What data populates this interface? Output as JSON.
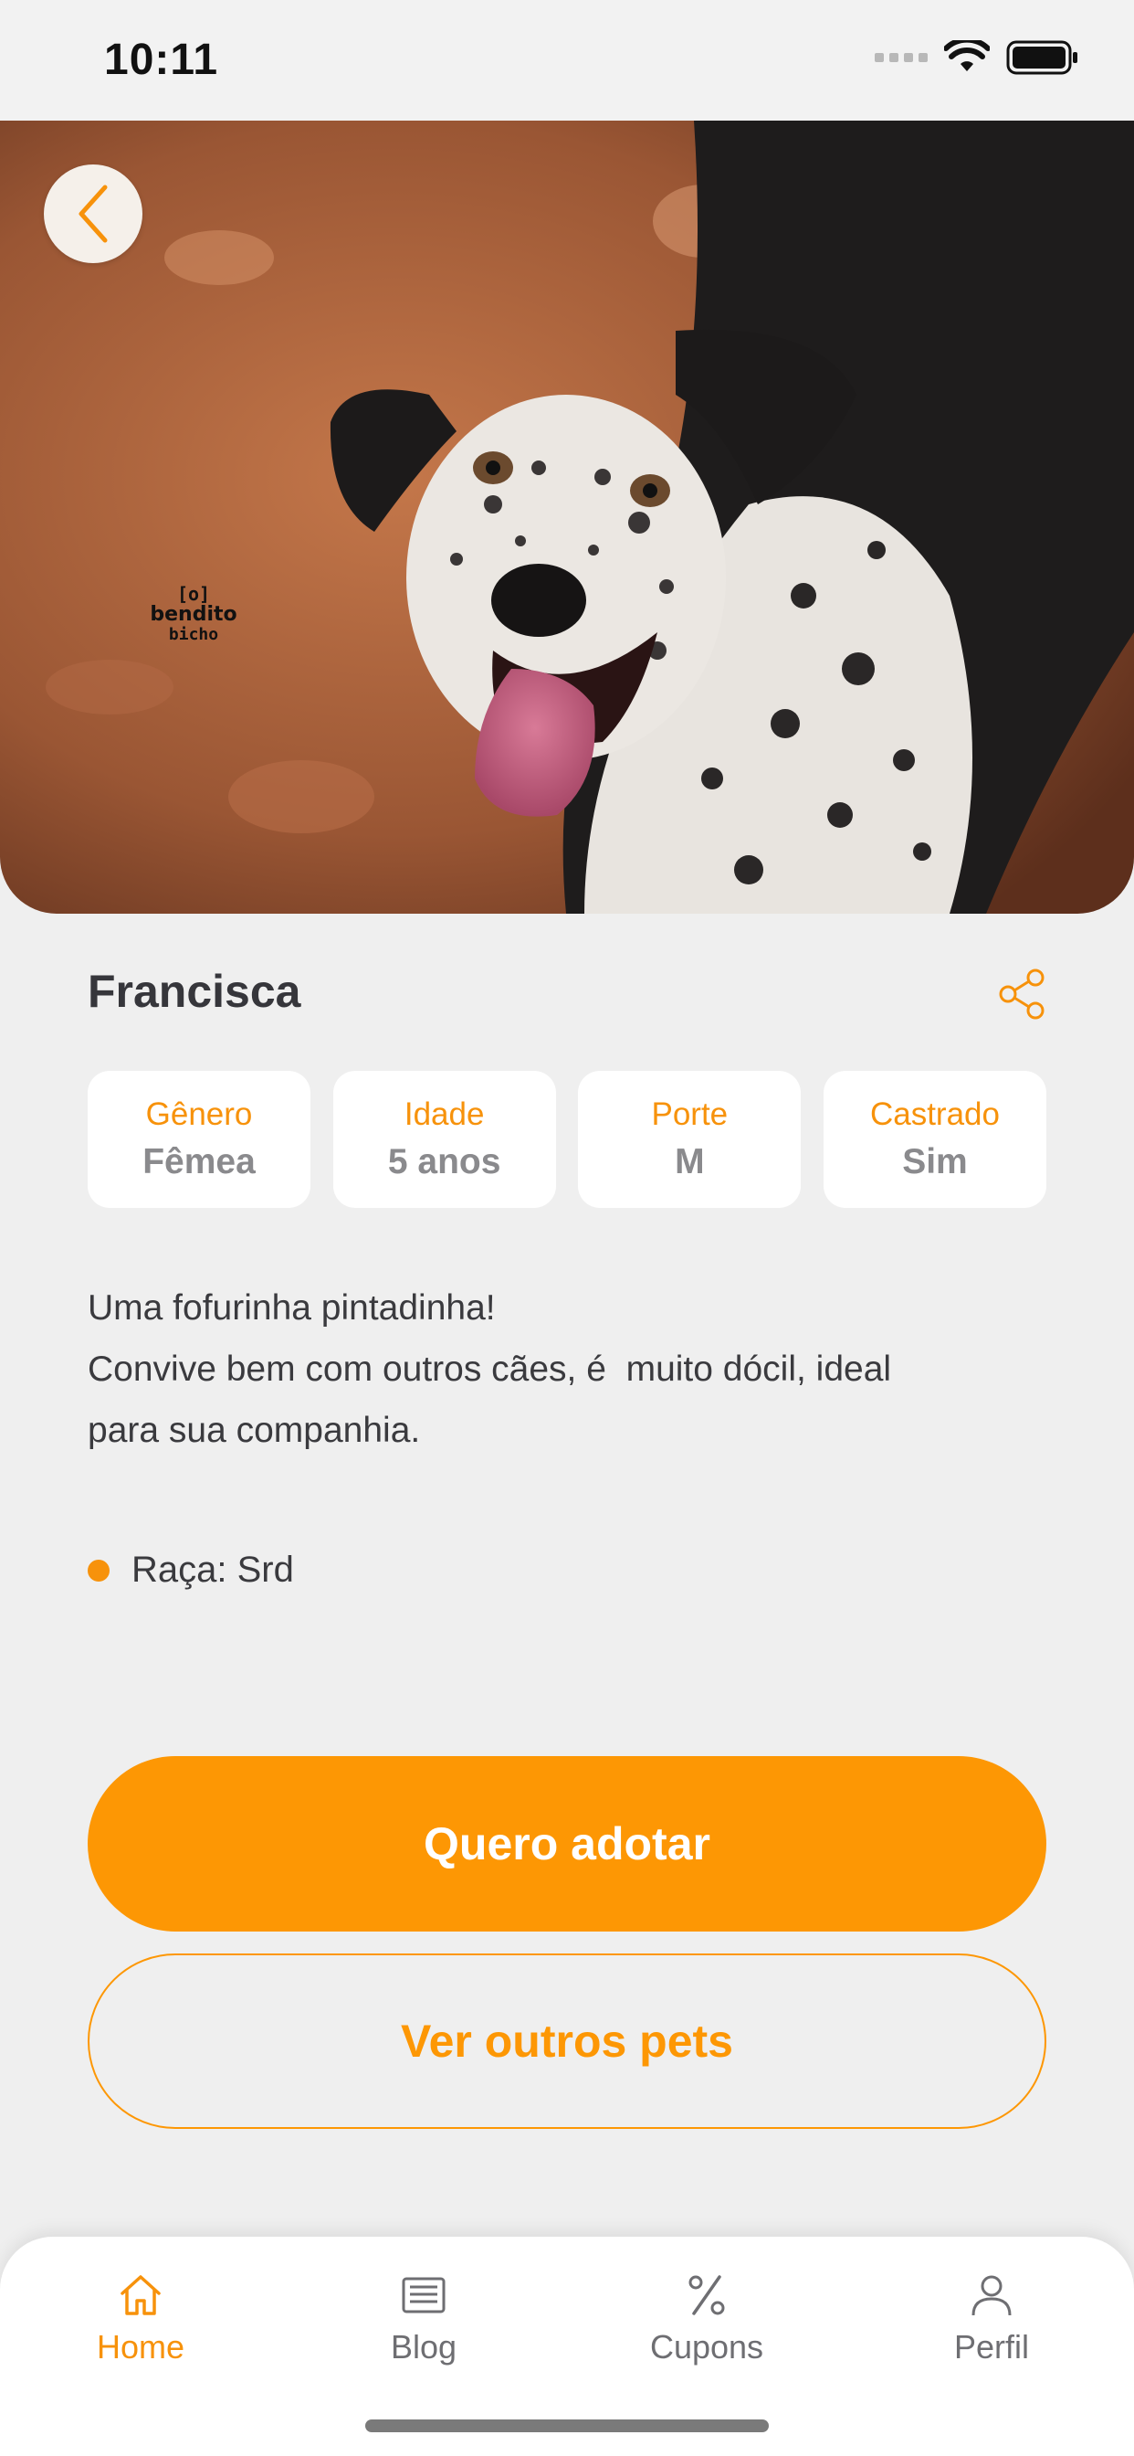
{
  "status_bar": {
    "time": "10:11"
  },
  "hero": {
    "watermark_top": "[o]",
    "watermark_mid": "bendito",
    "watermark_bottom": "bicho"
  },
  "pet": {
    "name": "Francisca",
    "attributes": [
      {
        "label": "Gênero",
        "value": "Fêmea"
      },
      {
        "label": "Idade",
        "value": "5 anos"
      },
      {
        "label": "Porte",
        "value": "M"
      },
      {
        "label": "Castrado",
        "value": "Sim"
      }
    ],
    "description": [
      "Uma fofurinha pintadinha!",
      "Convive bem com outros cães, é  muito dócil, ideal",
      "para sua companhia."
    ],
    "breed": "Raça: Srd"
  },
  "actions": {
    "adopt": "Quero adotar",
    "see_others": "Ver outros pets"
  },
  "tabbar": {
    "items": [
      {
        "label": "Home",
        "icon": "home-icon",
        "active": true
      },
      {
        "label": "Blog",
        "icon": "newspaper-icon",
        "active": false
      },
      {
        "label": "Cupons",
        "icon": "percent-icon",
        "active": false
      },
      {
        "label": "Perfil",
        "icon": "user-icon",
        "active": false
      }
    ]
  },
  "colors": {
    "accent": "#fd9704",
    "background": "#efefef"
  }
}
